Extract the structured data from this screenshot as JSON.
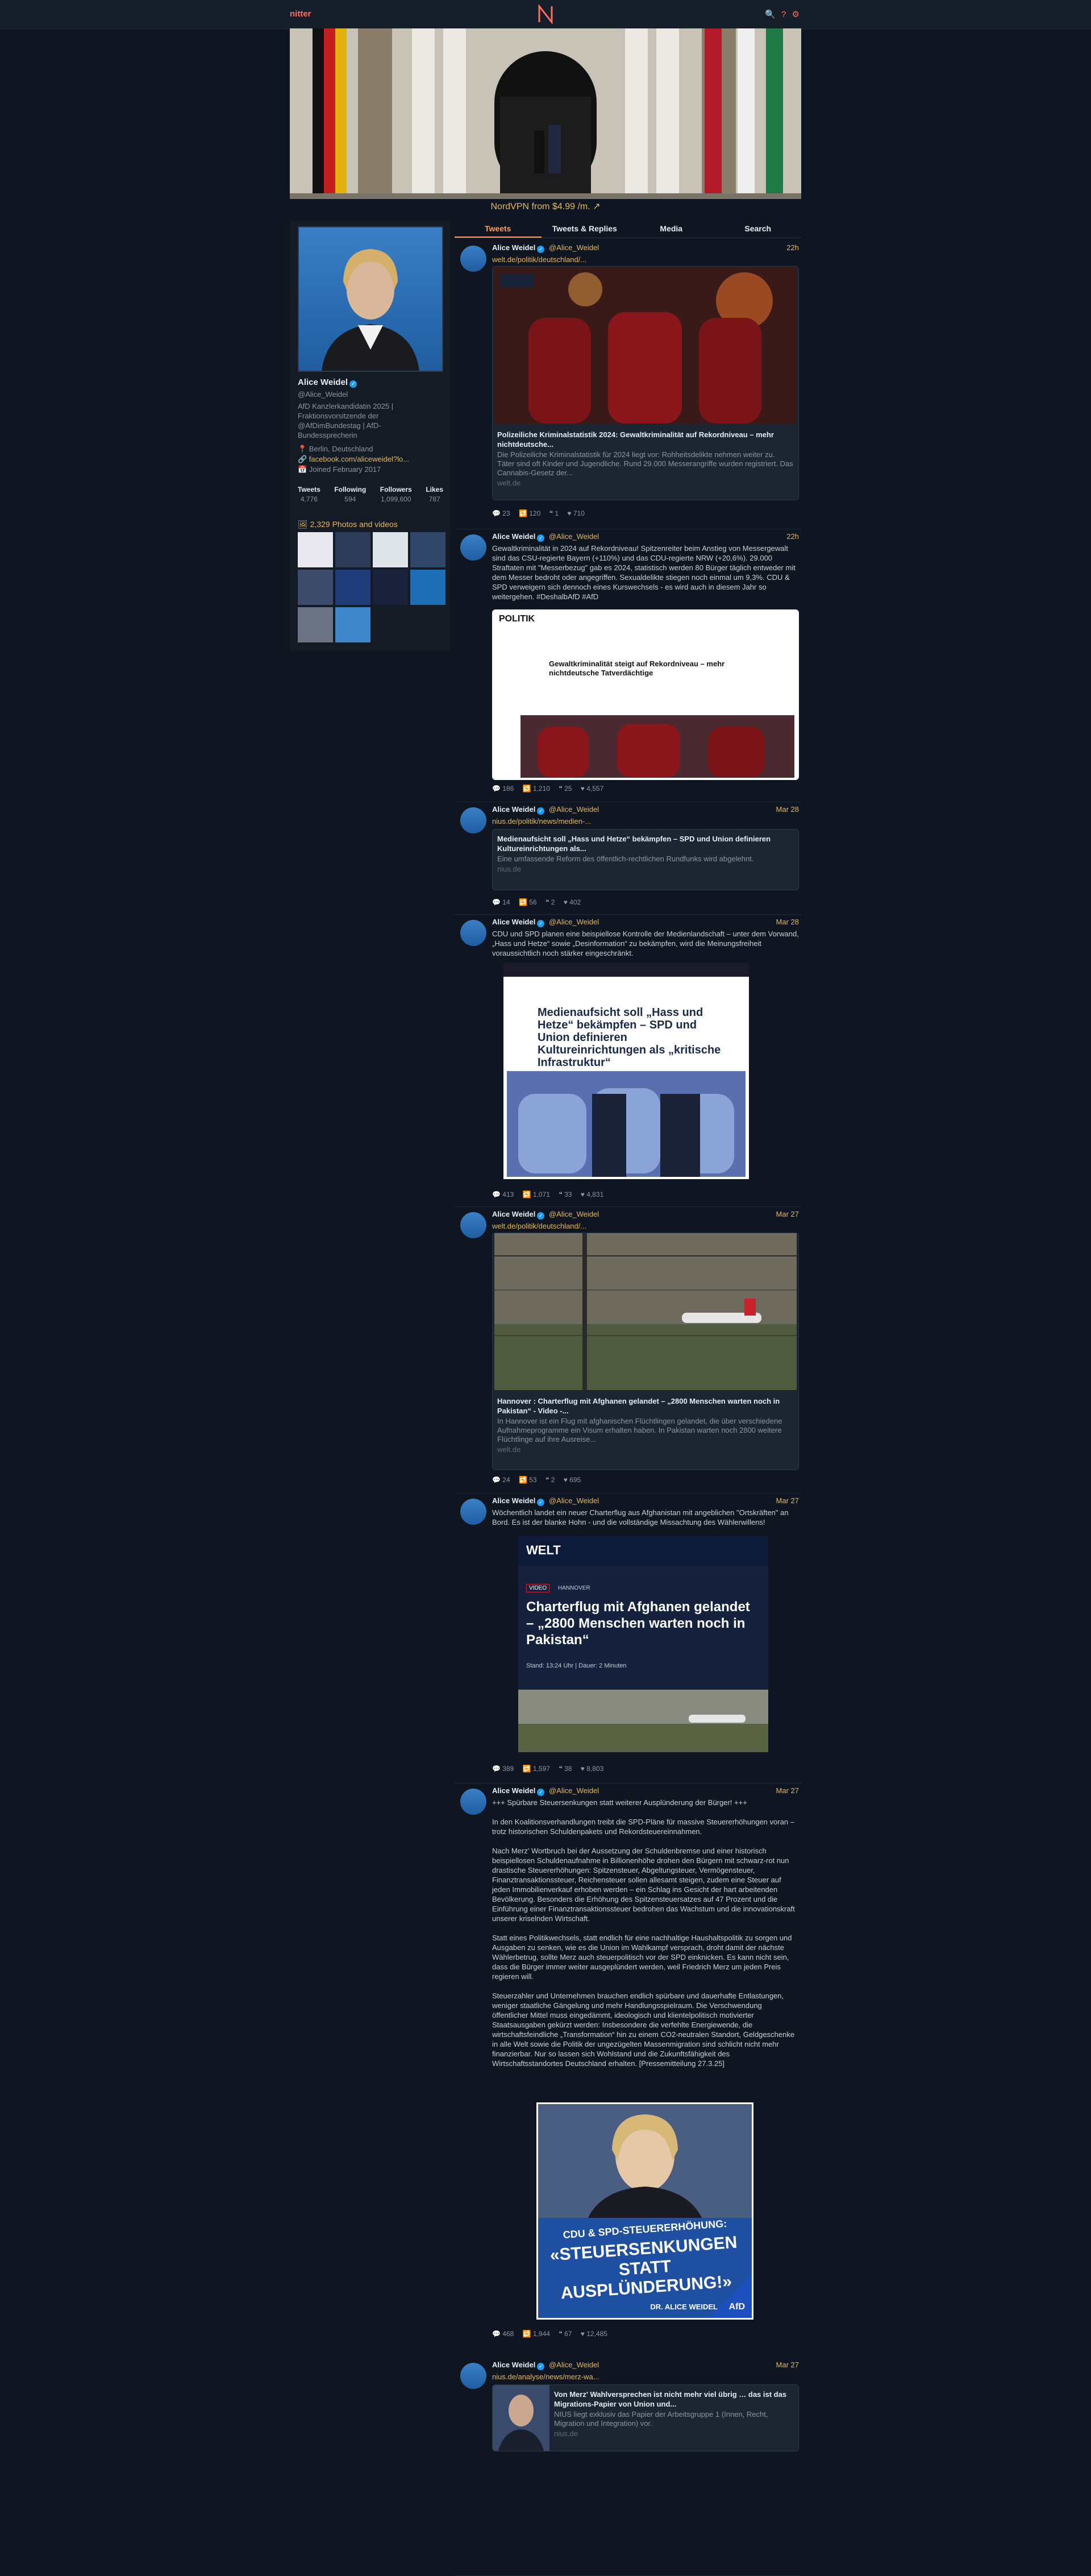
{
  "nav": {
    "brand": "nitter",
    "logo": "N",
    "icons": "🔍 ? ⚙"
  },
  "promo": "NordVPN from $4.99 /m. ↗",
  "profile": {
    "name": "Alice Weidel",
    "handle": "@Alice_Weidel",
    "bio": "AfD Kanzlerkandidatin 2025 | Fraktionsvorsitzende der @AfDimBundestag | AfD-Bundessprecherin",
    "location": "📍 Berlin, Deutschland",
    "website": "🔗 facebook.com/aliceweidel?lo...",
    "joined": "📅 Joined February 2017",
    "stats": [
      {
        "label": "Tweets",
        "value": "4,776"
      },
      {
        "label": "Following",
        "value": "594"
      },
      {
        "label": "Followers",
        "value": "1,099,600"
      },
      {
        "label": "Likes",
        "value": "787"
      }
    ],
    "photos_label": "🖼 2,329 Photos and videos"
  },
  "tabs": [
    "Tweets",
    "Tweets & Replies",
    "Media",
    "Search"
  ],
  "tweets": [
    {
      "name": "Alice Weidel",
      "handle": "@Alice_Weidel",
      "date": "22h",
      "link": "welt.de/politik/deutschland/...",
      "card_title": "Polizeiliche Kriminalstatistik 2024: Gewaltkriminalität auf Rekordniveau – mehr nichtdeutsche...",
      "card_desc": "Die Polizeiliche Kriminalstatistik für 2024 liegt vor: Rohheitsdelikte nehmen weiter zu. Täter sind oft Kinder und Jugendliche. Rund 29.000 Messerangriffe wurden registriert. Das Cannabis-Gesetz der...",
      "card_domain": "welt.de",
      "stats": [
        "💬 23",
        "🔁 120",
        "❝ 1",
        "♥ 710"
      ]
    },
    {
      "name": "Alice Weidel",
      "handle": "@Alice_Weidel",
      "date": "22h",
      "text": "Gewaltkriminalität in 2024 auf Rekordniveau! Spitzenreiter beim Anstieg von Messergewalt sind das CSU-regierte Bayern (+110%) und das CDU-regierte NRW (+20,6%). 29.000 Straftaten mit \"Messerbezug\" gab es 2024, statistisch werden 80 Bürger täglich entweder mit dem Messer bedroht oder angegriffen. Sexualdelikte stiegen noch einmal um 9,3%. CDU & SPD verweigern sich dennoch eines Kurswechsels - es wird auch in diesem Jahr so weitergehen. #DeshalbAfD #AfD",
      "img_section": "POLITIK",
      "img_head": "Gewaltkriminalität steigt auf Rekordniveau – mehr nichtdeutsche Tatverdächtige",
      "stats": [
        "💬 186",
        "🔁 1,210",
        "❝ 25",
        "♥ 4,557"
      ]
    },
    {
      "name": "Alice Weidel",
      "handle": "@Alice_Weidel",
      "date": "Mar 28",
      "link": "nius.de/politik/news/medien-...",
      "card_title": "Medienaufsicht soll „Hass und Hetze“ bekämpfen – SPD und Union definieren Kultureinrichtungen als...",
      "card_desc": "Eine umfassende Reform des öffentlich-rechtlichen Rundfunks wird abgelehnt.",
      "card_domain": "nius.de",
      "stats": [
        "💬 14",
        "🔁 56",
        "❝ 2",
        "♥ 402"
      ]
    },
    {
      "name": "Alice Weidel",
      "handle": "@Alice_Weidel",
      "date": "Mar 28",
      "text": "CDU und SPD planen eine beispiellose Kontrolle der Medienlandschaft – unter dem Vorwand, „Hass und Hetze“ sowie „Desinformation“ zu bekämpfen, wird die Meinungsfreiheit voraussichtlich noch stärker eingeschränkt.",
      "img_head": "Medienaufsicht soll „Hass und Hetze“ bekämpfen – SPD und Union definieren Kultureinrichtungen als „kritische Infrastruktur“",
      "stats": [
        "💬 413",
        "🔁 1,071",
        "❝ 33",
        "♥ 4,831"
      ]
    },
    {
      "name": "Alice Weidel",
      "handle": "@Alice_Weidel",
      "date": "Mar 27",
      "link": "welt.de/politik/deutschland/...",
      "card_title": "Hannover : Charterflug mit Afghanen gelandet – „2800 Menschen warten noch in Pakistan“ - Video -...",
      "card_desc": "In Hannover ist ein Flug mit afghanischen Flüchtlingen gelandet, die über verschiedene Aufnahmeprogramme ein Visum erhalten haben. In Pakistan warten noch 2800 weitere Flüchtlinge auf ihre Ausreise...",
      "card_domain": "welt.de",
      "stats": [
        "💬 24",
        "🔁 53",
        "❝ 2",
        "♥ 695"
      ]
    },
    {
      "name": "Alice Weidel",
      "handle": "@Alice_Weidel",
      "date": "Mar 27",
      "text": "Wöchentlich landet ein neuer Charterflug aus Afghanistan mit angeblichen \"Ortskräften\" an Bord. Es ist der blanke Hohn - und die vollständige Missachtung des Wählerwillens!",
      "img_brand": "WELT",
      "img_tag": "VIDEO",
      "img_sub": "HANNOVER",
      "img_head": "Charterflug mit Afghanen gelandet – „2800 Menschen warten noch in Pakistan“",
      "img_meta": "Stand: 13:24 Uhr | Dauer: 2 Minuten",
      "stats": [
        "💬 389",
        "🔁 1,597",
        "❝ 38",
        "♥ 8,803"
      ]
    },
    {
      "name": "Alice Weidel",
      "handle": "@Alice_Weidel",
      "date": "Mar 27",
      "text": "+++ Spürbare Steuersenkungen statt weiterer Ausplünderung der Bürger! +++\n\nIn den Koalitionsverhandlungen treibt die SPD-Pläne für massive Steuererhöhungen voran – trotz historischen Schuldenpakets und Rekordsteuereinnahmen.\n\nNach Merz' Wortbruch bei der Aussetzung der Schuldenbremse und einer historisch beispiellosen Schuldenaufnahme in Billionenhöhe drohen den Bürgern mit schwarz-rot nun drastische Steuererhöhungen: Spitzensteuer, Abgeltungsteuer, Vermögensteuer, Finanztransaktionssteuer, Reichensteuer sollen allesamt steigen, zudem eine Steuer auf jeden Immobilienverkauf erhoben werden – ein Schlag ins Gesicht der hart arbeitenden Bevölkerung. Besonders die Erhöhung des Spitzensteuersatzes auf 47 Prozent und die Einführung einer Finanztransaktionssteuer bedrohen das Wachstum und die innovationskraft unserer kriselnden Wirtschaft.\n\nStatt eines Politikwechsels, statt endlich für eine nachhaltige Haushaltspolitik zu sorgen und Ausgaben zu senken, wie es die Union im Wahlkampf versprach, droht damit der nächste Wählerbetrug, sollte Merz auch steuerpolitisch vor der SPD einknicken. Es kann nicht sein, dass die Bürger immer weiter ausgeplündert werden, weil Friedrich Merz um jeden Preis regieren will.\n\nSteuerzahler und Unternehmen brauchen endlich spürbare und dauerhafte Entlastungen, weniger staatliche Gängelung und mehr Handlungsspielraum. Die Verschwendung öffentlicher Mittel muss eingedämmt, ideologisch und klientelpolitisch motivierter Staatsausgaben gekürzt werden: Insbesondere die verfehlte Energiewende, die wirtschaftsfeindliche „Transformation“ hin zu einem CO2-neutralen Standort, Geldgeschenke in alle Welt sowie die Politik der ungezügelten Massenmigration sind schlicht nicht mehr finanzierbar. Nur so lassen sich Wohlstand und die Zukunftsfähigkeit des Wirtschaftsstandortes Deutschland erhalten. [Pressemitteilung 27.3.25]",
      "img_l1": "CDU & SPD-STEUERERHÖHUNG:",
      "img_l2": "«STEUERSENKUNGEN STATT AUSPLÜNDERUNG!»",
      "img_sig": "DR. ALICE WEIDEL",
      "img_logo": "AfD",
      "stats": [
        "💬 468",
        "🔁 1,944",
        "❝ 67",
        "♥ 12,485"
      ]
    },
    {
      "name": "Alice Weidel",
      "handle": "@Alice_Weidel",
      "date": "Mar 27",
      "link": "nius.de/analyse/news/merz-wa...",
      "card_title": "Von Merz' Wahlversprechen ist nicht mehr viel übrig … das ist das Migrations-Papier von Union und...",
      "card_desc": "NIUS liegt exklusiv das Papier der Arbeitsgruppe 1 (Innen, Recht, Migration und Integration) vor.",
      "card_domain": "nius.de"
    }
  ]
}
